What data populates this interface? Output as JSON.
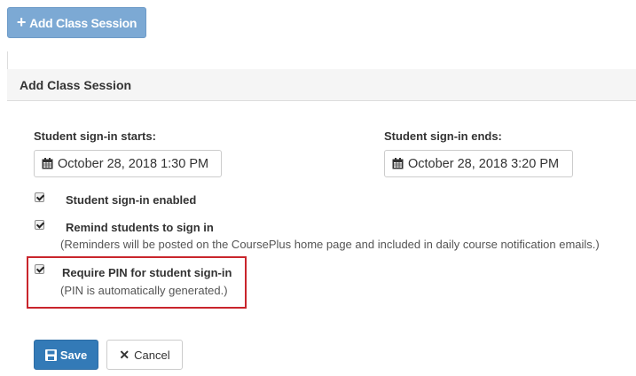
{
  "toolbar": {
    "add_session_label": "Add Class Session",
    "add_icon": "plus-icon"
  },
  "panel": {
    "title": "Add Class Session"
  },
  "signin_start": {
    "label": "Student sign-in starts:",
    "value": "October 28, 2018 1:30 PM",
    "icon": "calendar-icon"
  },
  "signin_end": {
    "label": "Student sign-in ends:",
    "value": "October 28, 2018 3:20 PM",
    "icon": "calendar-icon"
  },
  "options": [
    {
      "label": "Student sign-in enabled",
      "checked": true,
      "note": ""
    },
    {
      "label": "Remind students to sign in",
      "checked": true,
      "note": "(Reminders will be posted on the CoursePlus home page and included in daily course notification emails.)"
    },
    {
      "label": "Require PIN for student sign-in",
      "checked": true,
      "note": "(PIN is automatically generated.)",
      "highlighted": true
    }
  ],
  "actions": {
    "save_label": "Save",
    "cancel_label": "Cancel",
    "save_icon": "floppy-disk-icon",
    "cancel_icon": "close-icon"
  },
  "colors": {
    "primary": "#337ab7",
    "primary_disabled": "#7ca9d4",
    "highlight_border": "#c9252c"
  }
}
